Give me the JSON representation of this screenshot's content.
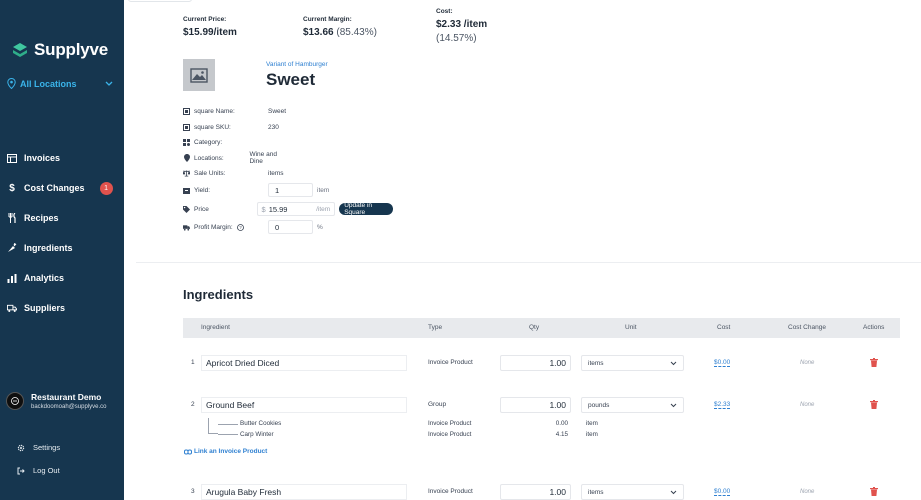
{
  "brand": {
    "name": "Supplyve",
    "accent": "#3ab4ea",
    "sidebar_bg": "#16364f"
  },
  "location": {
    "label": "All Locations"
  },
  "nav": [
    {
      "label": "Invoices",
      "icon": "invoice-icon"
    },
    {
      "label": "Cost Changes",
      "icon": "dollar-icon",
      "badge": "1"
    },
    {
      "label": "Recipes",
      "icon": "utensils-icon"
    },
    {
      "label": "Ingredients",
      "icon": "carrot-icon"
    },
    {
      "label": "Analytics",
      "icon": "bar-chart-icon"
    },
    {
      "label": "Suppliers",
      "icon": "truck-icon"
    }
  ],
  "user": {
    "name": "Restaurant Demo",
    "email": "backdoomoah@supplyve.co"
  },
  "bottom": {
    "settings": "Settings",
    "logout": "Log Out"
  },
  "stats": {
    "price_label": "Current Price:",
    "price_value": "$15.99/item",
    "margin_label": "Current Margin:",
    "margin_value": "$13.66",
    "margin_pct": "(85.43%)",
    "cost_label": "Cost:",
    "cost_value": "$2.33 /item",
    "cost_pct": "(14.57%)"
  },
  "product": {
    "variant_of": "Variant of Hamburger",
    "title": "Sweet",
    "fields": {
      "name_label": "square Name:",
      "name_value": "Sweet",
      "sku_label": "square SKU:",
      "sku_value": "230",
      "category_label": "Category:",
      "locations_label": "Locations:",
      "locations_value": "Wine and Dine",
      "sale_units_label": "Sale Units:",
      "sale_units_value": "items",
      "yield_label": "Yield:",
      "yield_value": "1",
      "yield_unit": "item",
      "price_label": "Price",
      "price_currency": "$",
      "price_value": "15.99",
      "price_unit": "/item",
      "update_button": "Update in Square",
      "profit_label": "Profit Margin:",
      "profit_value": "0",
      "profit_unit": "%"
    }
  },
  "ingredients": {
    "title": "Ingredients",
    "columns": {
      "ingredient": "Ingredient",
      "type": "Type",
      "qty": "Qty",
      "unit": "Unit",
      "cost": "Cost",
      "cost_change": "Cost Change",
      "actions": "Actions"
    },
    "rows": [
      {
        "num": "1",
        "name": "Apricot Dried Diced",
        "type": "Invoice Product",
        "qty": "1.00",
        "unit": "items",
        "cost": "$0.00",
        "change": "None"
      },
      {
        "num": "2",
        "name": "Ground Beef",
        "type": "Group",
        "qty": "1.00",
        "unit": "pounds",
        "cost": "$2.33",
        "change": "None"
      },
      {
        "num": "3",
        "name": "Arugula Baby Fresh",
        "type": "Invoice Product",
        "qty": "1.00",
        "unit": "items",
        "cost": "$0.00",
        "change": "None"
      }
    ],
    "subrows": [
      {
        "name": "Butter Cookies",
        "type": "Invoice Product",
        "qty": "0.00",
        "unit": "item"
      },
      {
        "name": "Carp Winter",
        "type": "Invoice Product",
        "qty": "4.15",
        "unit": "item"
      }
    ],
    "link_label": "Link an Invoice Product"
  }
}
